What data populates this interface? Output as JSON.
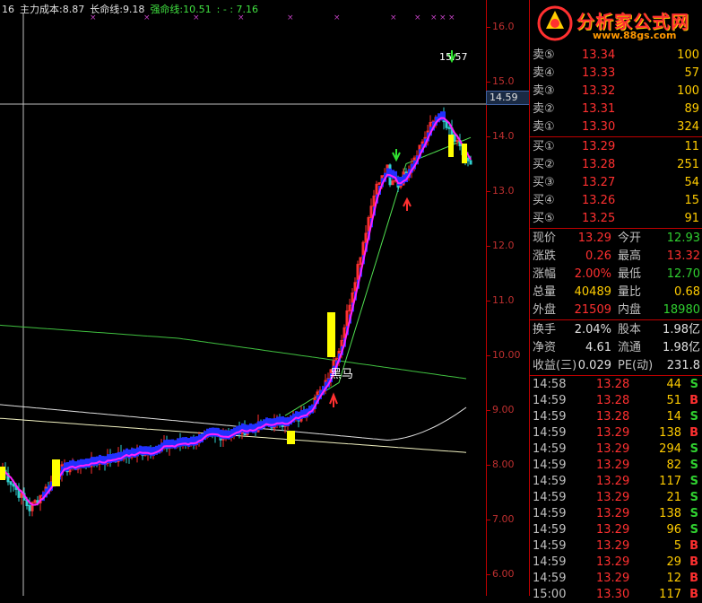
{
  "legend": {
    "period": "16",
    "main_cost_label": "主力成本:",
    "main_cost_value": "8.87",
    "long_line_label": "长命线:",
    "long_line_value": "9.18",
    "strong_line_label": "强命线:",
    "strong_line_value": "10.51",
    "extra": ": - : 7.16"
  },
  "price_axis": {
    "ticks": [
      "16.0",
      "15.0",
      "14.0",
      "13.0",
      "12.0",
      "11.0",
      "10.00",
      "9.00",
      "8.00",
      "7.00",
      "6.00"
    ],
    "current_price": "14.59"
  },
  "annotations": {
    "heima": "黑马",
    "peak": "15.57"
  },
  "logo": {
    "name": "分析家公式网",
    "url": "www.88gs.com"
  },
  "order_book": {
    "asks": [
      {
        "label": "卖⑤",
        "price": "13.34",
        "volume": "100"
      },
      {
        "label": "卖④",
        "price": "13.33",
        "volume": "57"
      },
      {
        "label": "卖③",
        "price": "13.32",
        "volume": "100"
      },
      {
        "label": "卖②",
        "price": "13.31",
        "volume": "89"
      },
      {
        "label": "卖①",
        "price": "13.30",
        "volume": "324"
      }
    ],
    "bids": [
      {
        "label": "买①",
        "price": "13.29",
        "volume": "11"
      },
      {
        "label": "买②",
        "price": "13.28",
        "volume": "251"
      },
      {
        "label": "买③",
        "price": "13.27",
        "volume": "54"
      },
      {
        "label": "买④",
        "price": "13.26",
        "volume": "15"
      },
      {
        "label": "买⑤",
        "price": "13.25",
        "volume": "91"
      }
    ]
  },
  "quote_stats": [
    {
      "l1": "现价",
      "v1": "13.29",
      "c1": "red",
      "l2": "今开",
      "v2": "12.93",
      "c2": "green"
    },
    {
      "l1": "涨跌",
      "v1": "0.26",
      "c1": "red",
      "l2": "最高",
      "v2": "13.32",
      "c2": "red"
    },
    {
      "l1": "涨幅",
      "v1": "2.00%",
      "c1": "red",
      "l2": "最低",
      "v2": "12.70",
      "c2": "green"
    },
    {
      "l1": "总量",
      "v1": "40489",
      "c1": "yellow",
      "l2": "量比",
      "v2": "0.68",
      "c2": "yellow"
    },
    {
      "l1": "外盘",
      "v1": "21509",
      "c1": "red",
      "l2": "内盘",
      "v2": "18980",
      "c2": "green"
    }
  ],
  "fin_stats": [
    {
      "l1": "换手",
      "v1": "2.04%",
      "l2": "股本",
      "v2": "1.98亿"
    },
    {
      "l1": "净资",
      "v1": "4.61",
      "l2": "流通",
      "v2": "1.98亿"
    },
    {
      "l1": "收益(三)",
      "v1": "0.029",
      "l2": "PE(动)",
      "v2": "231.8"
    }
  ],
  "ticks": [
    {
      "time": "14:58",
      "price": "13.28",
      "volume": "44",
      "side": "S"
    },
    {
      "time": "14:59",
      "price": "13.28",
      "volume": "51",
      "side": "B"
    },
    {
      "time": "14:59",
      "price": "13.28",
      "volume": "14",
      "side": "S"
    },
    {
      "time": "14:59",
      "price": "13.29",
      "volume": "138",
      "side": "B"
    },
    {
      "time": "14:59",
      "price": "13.29",
      "volume": "294",
      "side": "S"
    },
    {
      "time": "14:59",
      "price": "13.29",
      "volume": "82",
      "side": "S"
    },
    {
      "time": "14:59",
      "price": "13.29",
      "volume": "117",
      "side": "S"
    },
    {
      "time": "14:59",
      "price": "13.29",
      "volume": "21",
      "side": "S"
    },
    {
      "time": "14:59",
      "price": "13.29",
      "volume": "138",
      "side": "S"
    },
    {
      "time": "14:59",
      "price": "13.29",
      "volume": "96",
      "side": "S"
    },
    {
      "time": "14:59",
      "price": "13.29",
      "volume": "5",
      "side": "B"
    },
    {
      "time": "14:59",
      "price": "13.29",
      "volume": "29",
      "side": "B"
    },
    {
      "time": "14:59",
      "price": "13.29",
      "volume": "12",
      "side": "B"
    },
    {
      "time": "15:00",
      "price": "13.30",
      "volume": "117",
      "side": "B"
    },
    {
      "time": "15:00",
      "price": "13.29",
      "volume": "",
      "side": ""
    }
  ],
  "colors": {
    "up": "#ff3030",
    "down": "#30d0d0",
    "magenta_line": "#ff20ff",
    "blue_band": "#2030ff",
    "green_line": "#40c040",
    "white_line": "#e0e0e0",
    "highlight": "#ffff00"
  }
}
